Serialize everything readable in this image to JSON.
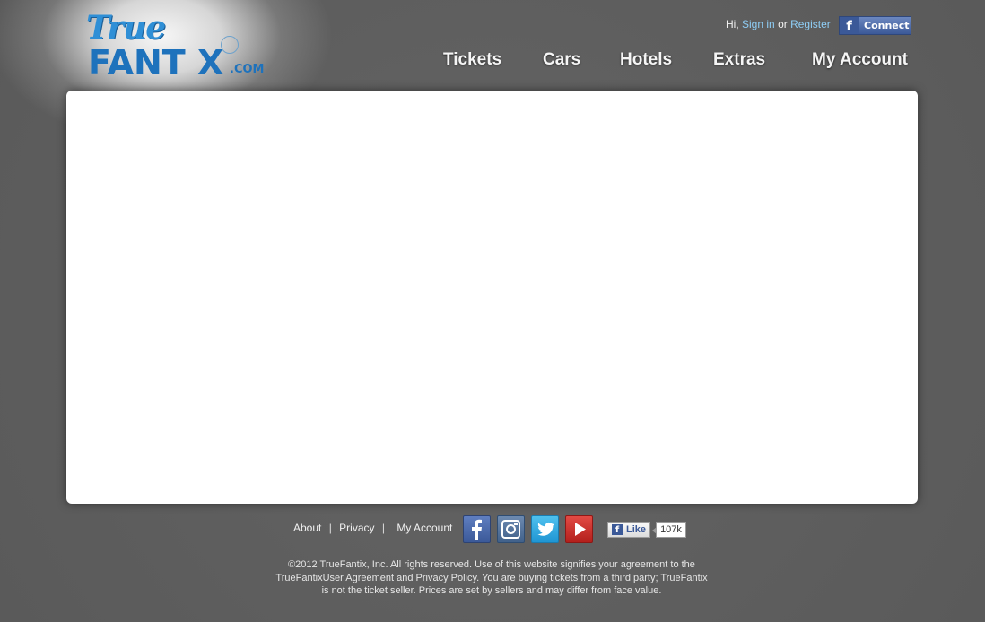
{
  "brand": {
    "logo_true": "True",
    "logo_fantix": "FANT X",
    "logo_com": ".COM"
  },
  "header": {
    "greeting": "Hi,",
    "sign_in": "Sign in",
    "or": "or",
    "register": "Register",
    "fb_connect_label": "Connect",
    "fb_icon_glyph": "f"
  },
  "nav": {
    "tickets": "Tickets",
    "cars": "Cars",
    "hotels": "Hotels",
    "extras": "Extras",
    "my_account": "My Account"
  },
  "footer": {
    "about": "About",
    "privacy": "Privacy",
    "my_account": "My Account",
    "sep": "|",
    "like_label": "Like",
    "like_count": "107k",
    "copyright_line1": "©2012 TrueFantix, Inc. All rights reserved. Use of this website signifies your agreement to the",
    "copyright_line2": "TrueFantixUser Agreement and Privacy Policy. You are buying tickets from a third party; TrueFantix",
    "copyright_line3": "is not the ticket seller. Prices are set by sellers and may differ from face value."
  },
  "social": {
    "icons": [
      "facebook-icon",
      "instagram-icon",
      "twitter-icon",
      "youtube-icon"
    ]
  },
  "colors": {
    "background": "#5e5e5e",
    "brand_blue": "#1e72bc",
    "link_blue": "#8ecdf5",
    "facebook": "#3b5998",
    "twitter": "#2aa9e0",
    "youtube": "#c4302b"
  }
}
